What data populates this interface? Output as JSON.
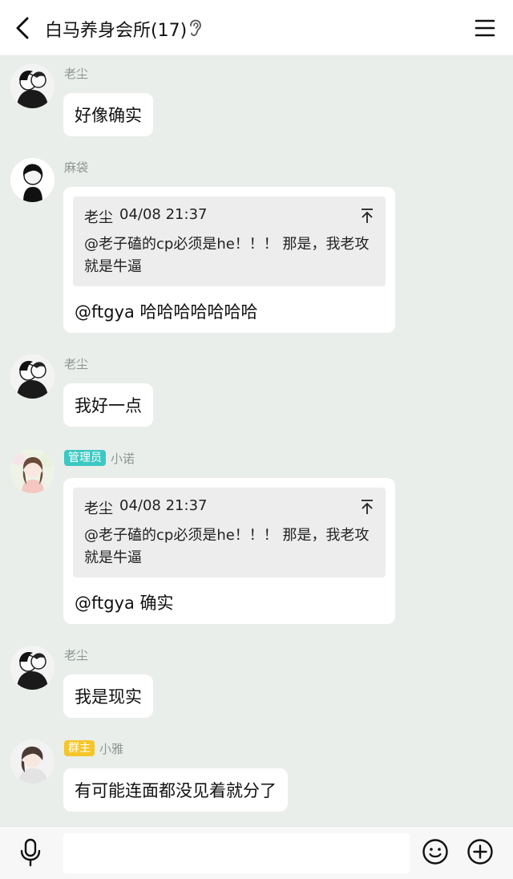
{
  "header": {
    "title": "白马养身会所(17)",
    "back_icon": "chevron-left-icon",
    "ear_icon": "ear-icon",
    "menu_icon": "hamburger-menu-icon"
  },
  "messages": [
    {
      "sender": "老尘",
      "text": "好像确实"
    },
    {
      "sender": "麻袋",
      "quote": {
        "author": "老尘",
        "time": "04/08 21:37",
        "text": "@老子磕的cp必须是he！！！ 那是，我老攻就是牛逼"
      },
      "text": "@ftgya 哈哈哈哈哈哈哈"
    },
    {
      "sender": "老尘",
      "text": "我好一点"
    },
    {
      "sender": "小诺",
      "badge": "管理员",
      "quote": {
        "author": "老尘",
        "time": "04/08 21:37",
        "text": "@老子磕的cp必须是he！！！ 那是，我老攻就是牛逼"
      },
      "text": "@ftgya 确实"
    },
    {
      "sender": "老尘",
      "text": "我是现实"
    },
    {
      "sender": "小雅",
      "badge": "群主",
      "text": "有可能连面都没见着就分了"
    }
  ],
  "input_bar": {
    "mic_icon": "microphone-icon",
    "emoji_icon": "emoji-icon",
    "plus_icon": "plus-icon",
    "input_value": ""
  },
  "colors": {
    "chat_bg": "#e9eeea",
    "bubble_bg": "#ffffff",
    "admin_badge": "#3cc8c3",
    "owner_badge": "#f5c62a",
    "quote_bg": "#ededed"
  }
}
